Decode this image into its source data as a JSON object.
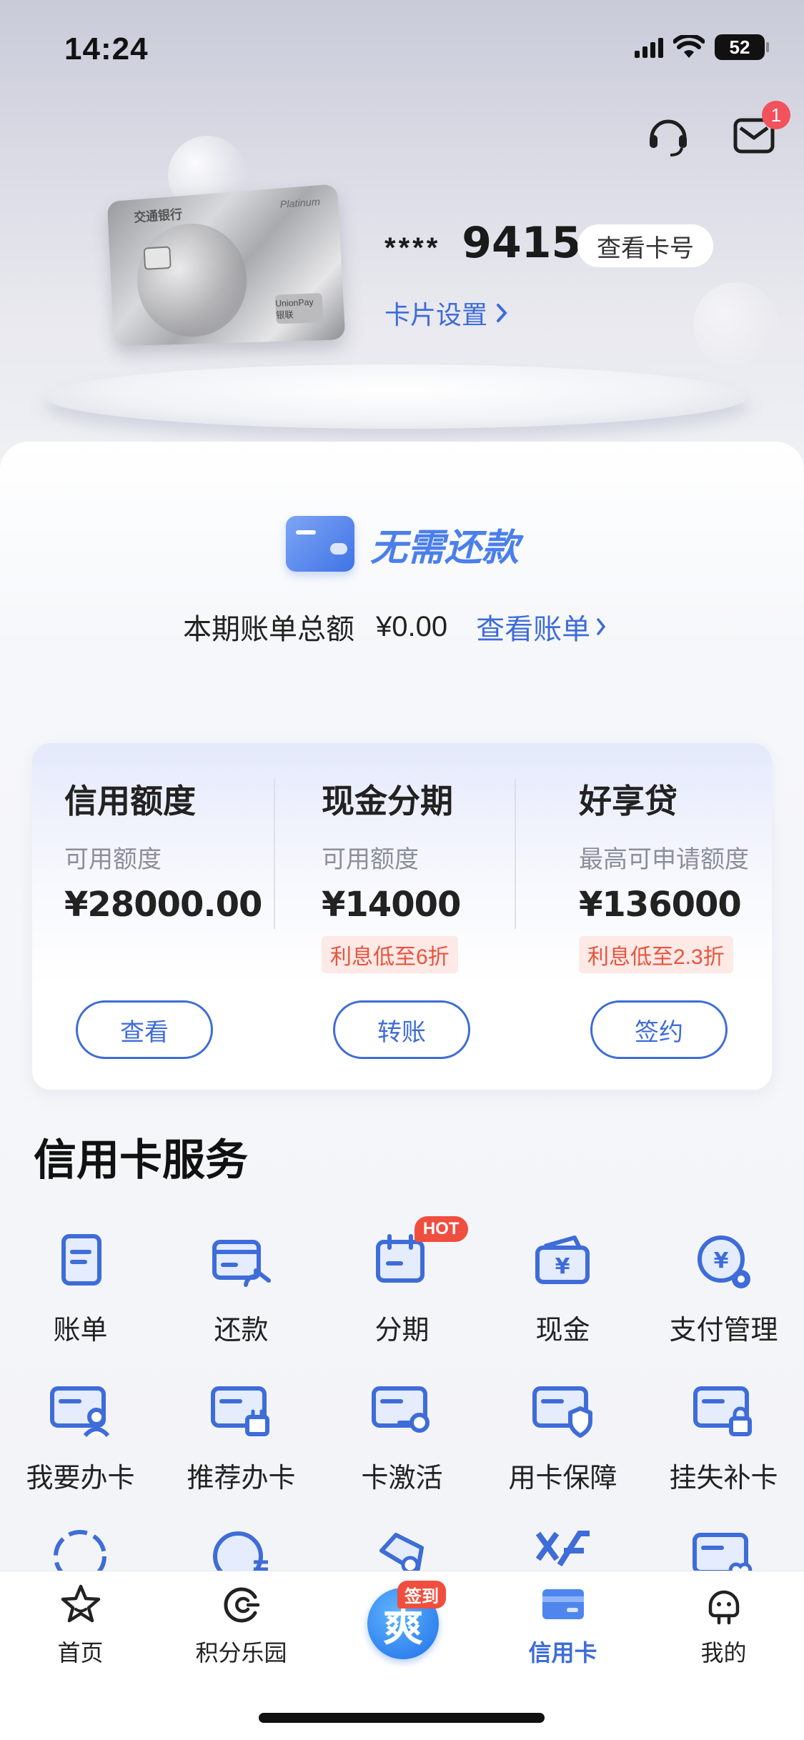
{
  "status_bar": {
    "time": "14:24",
    "battery": "52"
  },
  "header": {
    "mail_badge": "1"
  },
  "card": {
    "masked": "****",
    "last4": "9415",
    "view_number_label": "查看卡号",
    "settings_label": "卡片设置",
    "brand_text": "交通银行",
    "tier_text": "Platinum",
    "network_text": "UnionPay 银联"
  },
  "bill": {
    "status": "无需还款",
    "total_label": "本期账单总额",
    "total_amount": "¥0.00",
    "view_bill_label": "查看账单"
  },
  "quotas": [
    {
      "title": "信用额度",
      "sub": "可用额度",
      "value": "¥28000.00",
      "tag": "",
      "button": "查看"
    },
    {
      "title": "现金分期",
      "sub": "可用额度",
      "value": "¥14000",
      "tag": "利息低至6折",
      "button": "转账"
    },
    {
      "title": "好享贷",
      "sub": "最高可申请额度",
      "value": "¥136000",
      "tag": "利息低至2.3折",
      "button": "签约"
    }
  ],
  "services": {
    "title": "信用卡服务",
    "hot_label": "HOT",
    "items": [
      {
        "label": "账单",
        "icon": "bill-icon"
      },
      {
        "label": "还款",
        "icon": "repay-icon"
      },
      {
        "label": "分期",
        "icon": "installment-icon"
      },
      {
        "label": "现金",
        "icon": "cash-icon"
      },
      {
        "label": "支付管理",
        "icon": "payment-settings-icon"
      },
      {
        "label": "我要办卡",
        "icon": "apply-card-icon"
      },
      {
        "label": "推荐办卡",
        "icon": "recommend-card-icon"
      },
      {
        "label": "卡激活",
        "icon": "activate-card-icon"
      },
      {
        "label": "用卡保障",
        "icon": "card-protection-icon"
      },
      {
        "label": "挂失补卡",
        "icon": "report-loss-icon"
      }
    ]
  },
  "tabbar": {
    "items": [
      {
        "label": "首页",
        "icon": "star-icon"
      },
      {
        "label": "积分乐园",
        "icon": "points-icon"
      },
      {
        "label": "信用卡",
        "icon": "credit-card-icon"
      },
      {
        "label": "我的",
        "icon": "profile-icon"
      }
    ],
    "signin_badge": "签到",
    "signin_glyph": "爽"
  },
  "colors": {
    "accent": "#3e6cd8",
    "tag_red": "#e8543d",
    "badge_red": "#f04e3e"
  }
}
